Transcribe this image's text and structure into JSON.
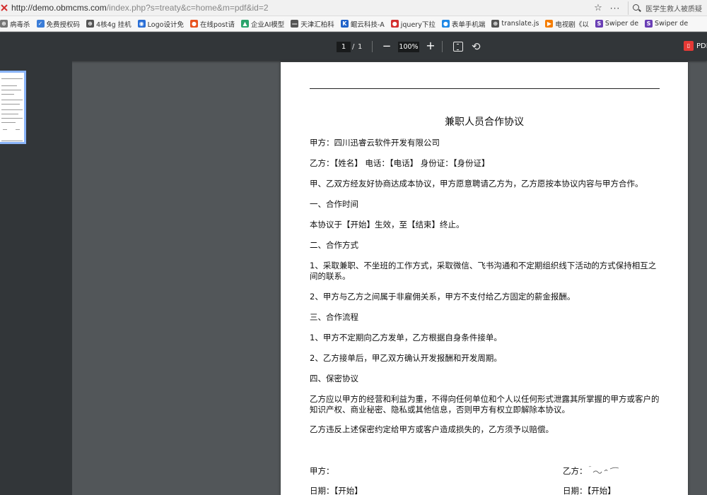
{
  "browser": {
    "url_host": "http://demo.obmcms.com",
    "url_path": "/index.php?s=treaty&c=home&m=pdf&id=2",
    "search_text": "医学生救人被质疑",
    "bookmarks": [
      {
        "label": "病毒杀",
        "icon_color": "#777777",
        "icon": "globe-icon"
      },
      {
        "label": "免费授权码",
        "icon_color": "#3b7dd8",
        "icon": "check-icon"
      },
      {
        "label": "4核4g 挂机",
        "icon_color": "#555555",
        "icon": "globe-icon"
      },
      {
        "label": "Logo设计免",
        "icon_color": "#2a6fd6",
        "icon": "logo-icon"
      },
      {
        "label": "在线post请",
        "icon_color": "#e8531f",
        "icon": "flame-icon"
      },
      {
        "label": "企业AI模型",
        "icon_color": "#2aa36b",
        "icon": "ai-icon"
      },
      {
        "label": "天津汇柏科",
        "icon_color": "#555555",
        "icon": "dash-icon"
      },
      {
        "label": "鲲云科技-A",
        "icon_color": "#1f62c9",
        "icon": "k-icon"
      },
      {
        "label": "jquery下拉",
        "icon_color": "#d32f2f",
        "icon": "dot-icon"
      },
      {
        "label": "表单手机端",
        "icon_color": "#1e88e5",
        "icon": "drop-icon"
      },
      {
        "label": "translate.js",
        "icon_color": "#555555",
        "icon": "globe-icon"
      },
      {
        "label": "电视剧《以",
        "icon_color": "#f57c00",
        "icon": "play-icon"
      },
      {
        "label": "Swiper de",
        "icon_color": "#6a3fb5",
        "icon": "s-icon"
      },
      {
        "label": "Swiper de",
        "icon_color": "#6a3fb5",
        "icon": "s-icon"
      }
    ]
  },
  "toolbar": {
    "page_current": "1",
    "page_sep": "/",
    "page_total": "1",
    "zoom_out": "−",
    "zoom": "100%",
    "zoom_in": "+",
    "pdf_label": "PDF"
  },
  "document": {
    "title": "兼职人员合作协议",
    "party_a": "甲方：四川迅睿云软件开发有限公司",
    "party_b": "乙方：【姓名】 电话：【电话】 身份证：【身份证】",
    "intro": "甲、乙双方经友好协商达成本协议，甲方愿意聘请乙方为，乙方愿按本协议内容与甲方合作。",
    "s1_title": "一、合作时间",
    "s1_body": "本协议于【开始】生效，至【结束】终止。",
    "s2_title": "二、合作方式",
    "s2_item1": "1、采取兼职、不坐班的工作方式，采取微信、飞书沟通和不定期组织线下活动的方式保持相互之间的联系。",
    "s2_item2": "2、甲方与乙方之间属于非雇佣关系，甲方不支付给乙方固定的薪金报酬。",
    "s3_title": "三、合作流程",
    "s3_item1": "1、甲方不定期向乙方发单，乙方根据自身条件接单。",
    "s3_item2": "2、乙方接单后，甲乙双方确认开发报酬和开发周期。",
    "s4_title": "四、保密协议",
    "s4_body1": "乙方应以甲方的经营和利益为重，不得向任何单位和个人以任何形式泄露其所掌握的甲方或客户的知识产权、商业秘密、隐私或其他信息，否则甲方有权立即解除本协议。",
    "s4_body2": "乙方违反上述保密约定给甲方或客户造成损失的，乙方须予以赔偿。",
    "sign_a": "甲方：",
    "sign_b": "乙方：",
    "date_a": "日期：【开始】",
    "date_b": "日期：【开始】"
  }
}
